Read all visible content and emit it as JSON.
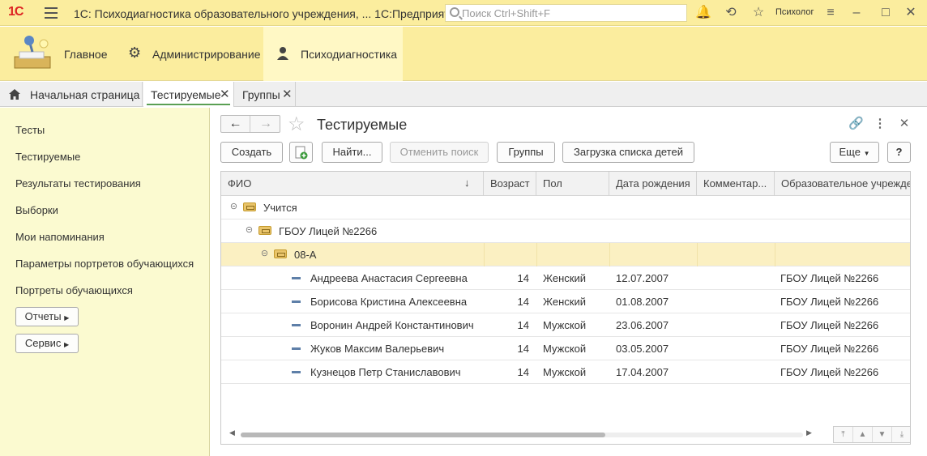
{
  "app": {
    "logo": "1С",
    "title": "1С: Психодиагностика образовательного учреждения, ...  1С:Предприятие",
    "search_placeholder": "Поиск Ctrl+Shift+F",
    "user": "Психолог"
  },
  "sections": [
    {
      "label": "Главное"
    },
    {
      "label": "Администрирование"
    },
    {
      "label": "Психодиагностика"
    }
  ],
  "tabs": [
    {
      "label": "Начальная страница"
    },
    {
      "label": "Тестируемые"
    },
    {
      "label": "Группы"
    }
  ],
  "leftnav": {
    "items": [
      "Тесты",
      "Тестируемые",
      "Результаты тестирования",
      "Выборки",
      "Мои напоминания",
      "Параметры портретов обучающихся",
      "Портреты обучающихся"
    ],
    "reports_button": "Отчеты",
    "service_button": "Сервис"
  },
  "form": {
    "title": "Тестируемые",
    "buttons": {
      "create": "Создать",
      "find": "Найти...",
      "cancel_search": "Отменить поиск",
      "groups": "Группы",
      "load_children": "Загрузка списка детей",
      "more": "Еще",
      "help": "?"
    }
  },
  "table": {
    "columns": [
      "ФИО",
      "Возраст",
      "Пол",
      "Дата рождения",
      "Комментар...",
      "Образовательное учрежде"
    ],
    "groups": [
      {
        "name": "Учится"
      },
      {
        "name": "ГБОУ Лицей №2266"
      },
      {
        "name": "08-А"
      }
    ],
    "rows": [
      {
        "name": "Андреева Анастасия Сергеевна",
        "age": "14",
        "sex": "Женский",
        "birth": "12.07.2007",
        "comment": "",
        "school": "ГБОУ Лицей №2266"
      },
      {
        "name": "Борисова Кристина Алексеевна",
        "age": "14",
        "sex": "Женский",
        "birth": "01.08.2007",
        "comment": "",
        "school": "ГБОУ Лицей №2266"
      },
      {
        "name": "Воронин Андрей Константинович",
        "age": "14",
        "sex": "Мужской",
        "birth": "23.06.2007",
        "comment": "",
        "school": "ГБОУ Лицей №2266"
      },
      {
        "name": "Жуков Максим Валерьевич",
        "age": "14",
        "sex": "Мужской",
        "birth": "03.05.2007",
        "comment": "",
        "school": "ГБОУ Лицей №2266"
      },
      {
        "name": "Кузнецов Петр Станиславович",
        "age": "14",
        "sex": "Мужской",
        "birth": "17.04.2007",
        "comment": "",
        "school": "ГБОУ Лицей №2266"
      }
    ]
  }
}
